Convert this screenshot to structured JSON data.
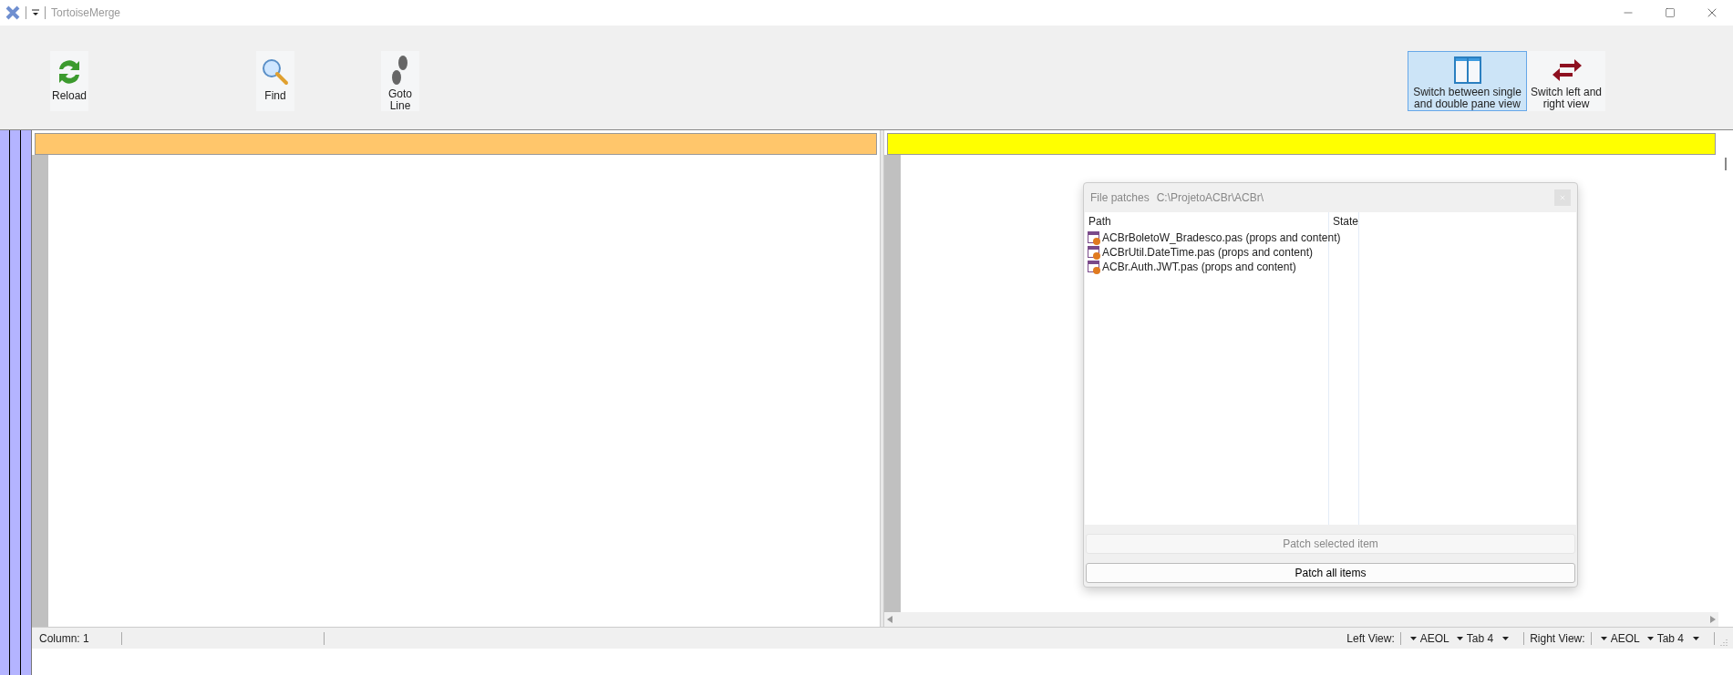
{
  "window": {
    "title": "TortoiseMerge"
  },
  "toolbar": [
    {
      "kind": "reload",
      "label": "Reload",
      "selected": false
    },
    {
      "kind": "find",
      "label": "Find",
      "selected": false
    },
    {
      "kind": "goto",
      "label": "Goto Line",
      "selected": false
    },
    {
      "kind": "panes",
      "label": "Switch between single and double pane view",
      "selected": true
    },
    {
      "kind": "swap",
      "label": "Switch left and right view",
      "selected": false
    }
  ],
  "panes": [
    {
      "color": "#ffc66b"
    },
    {
      "color": "#ffff00"
    }
  ],
  "dialog": {
    "title": "File patches",
    "path": "C:\\ProjetoACBr\\ACBr\\",
    "columns": [
      "Path",
      "State"
    ],
    "rows": [
      {
        "path": "ACBrBoletoW_Bradesco.pas (props and content)"
      },
      {
        "path": "ACBrUtil.DateTime.pas (props and content)"
      },
      {
        "path": "ACBr.Auth.JWT.pas (props and content)"
      }
    ],
    "buttons": [
      {
        "label": "Patch selected item",
        "disabled": true
      },
      {
        "label": "Patch all items",
        "disabled": false
      }
    ]
  },
  "status_bar": {
    "column": "Column: 1",
    "views": [
      {
        "label": "Left View:",
        "eol": "AEOL",
        "tab": "Tab 4"
      },
      {
        "label": "Right View:",
        "eol": "AEOL",
        "tab": "Tab 4"
      }
    ]
  }
}
